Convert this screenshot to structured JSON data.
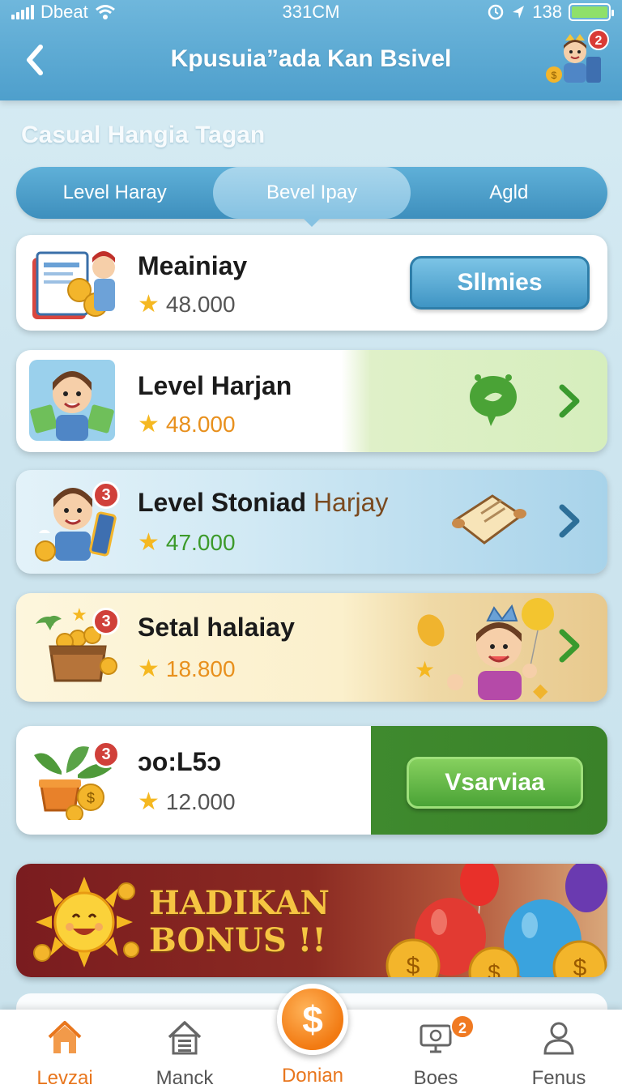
{
  "status_bar": {
    "carrier": "Dbeat",
    "time": "331CM",
    "right_text": "138",
    "battery_level": 1.0
  },
  "header": {
    "title": "Kpusuia”ada Kan Bsivel",
    "notification_count": "2",
    "back_icon": "chevron-left-icon"
  },
  "section_title": "Casual Hangia Tagan",
  "tabs": [
    {
      "label": "Level Haray",
      "active": false
    },
    {
      "label": "Bevel Ipay",
      "active": true
    },
    {
      "label": "Agld",
      "active": false
    }
  ],
  "cards": [
    {
      "name": "Meainiay",
      "score": "48.000",
      "button": "Sllmies",
      "score_color": "#555555"
    },
    {
      "name": "Level Harjan",
      "score": "48.000",
      "score_color": "#e8901d"
    },
    {
      "name_a": "Level Stoniad",
      "name_b": "Harjay",
      "badge": "3",
      "score": "47.000",
      "score_color": "#3c9a2a"
    },
    {
      "name": "Setal halaiay",
      "badge": "3",
      "score": "18.800",
      "score_color": "#e8901d"
    },
    {
      "name": "ɔo:L5ɔ",
      "badge": "3",
      "score": "12.000",
      "button": "Vsarviaa",
      "score_color": "#555555"
    }
  ],
  "banner": {
    "line1": "HADIKAN",
    "line2": "BONUS !!"
  },
  "bottom_nav": [
    {
      "label": "Levzai",
      "icon": "home-icon",
      "active": true
    },
    {
      "label": "Manck",
      "icon": "house-grid-icon",
      "active": false
    },
    {
      "label": "Donian",
      "icon": "dollar-coin-icon",
      "active": true
    },
    {
      "label": "Boes",
      "icon": "monitor-icon",
      "active": false,
      "badge": "2"
    },
    {
      "label": "Fenus",
      "icon": "profile-icon",
      "active": false
    }
  ],
  "center_button_symbol": "$",
  "colors": {
    "header": "#4e9fcc",
    "accent_orange": "#f27a12",
    "green_button": "#4aa336",
    "blue_button": "#3f95c4"
  }
}
